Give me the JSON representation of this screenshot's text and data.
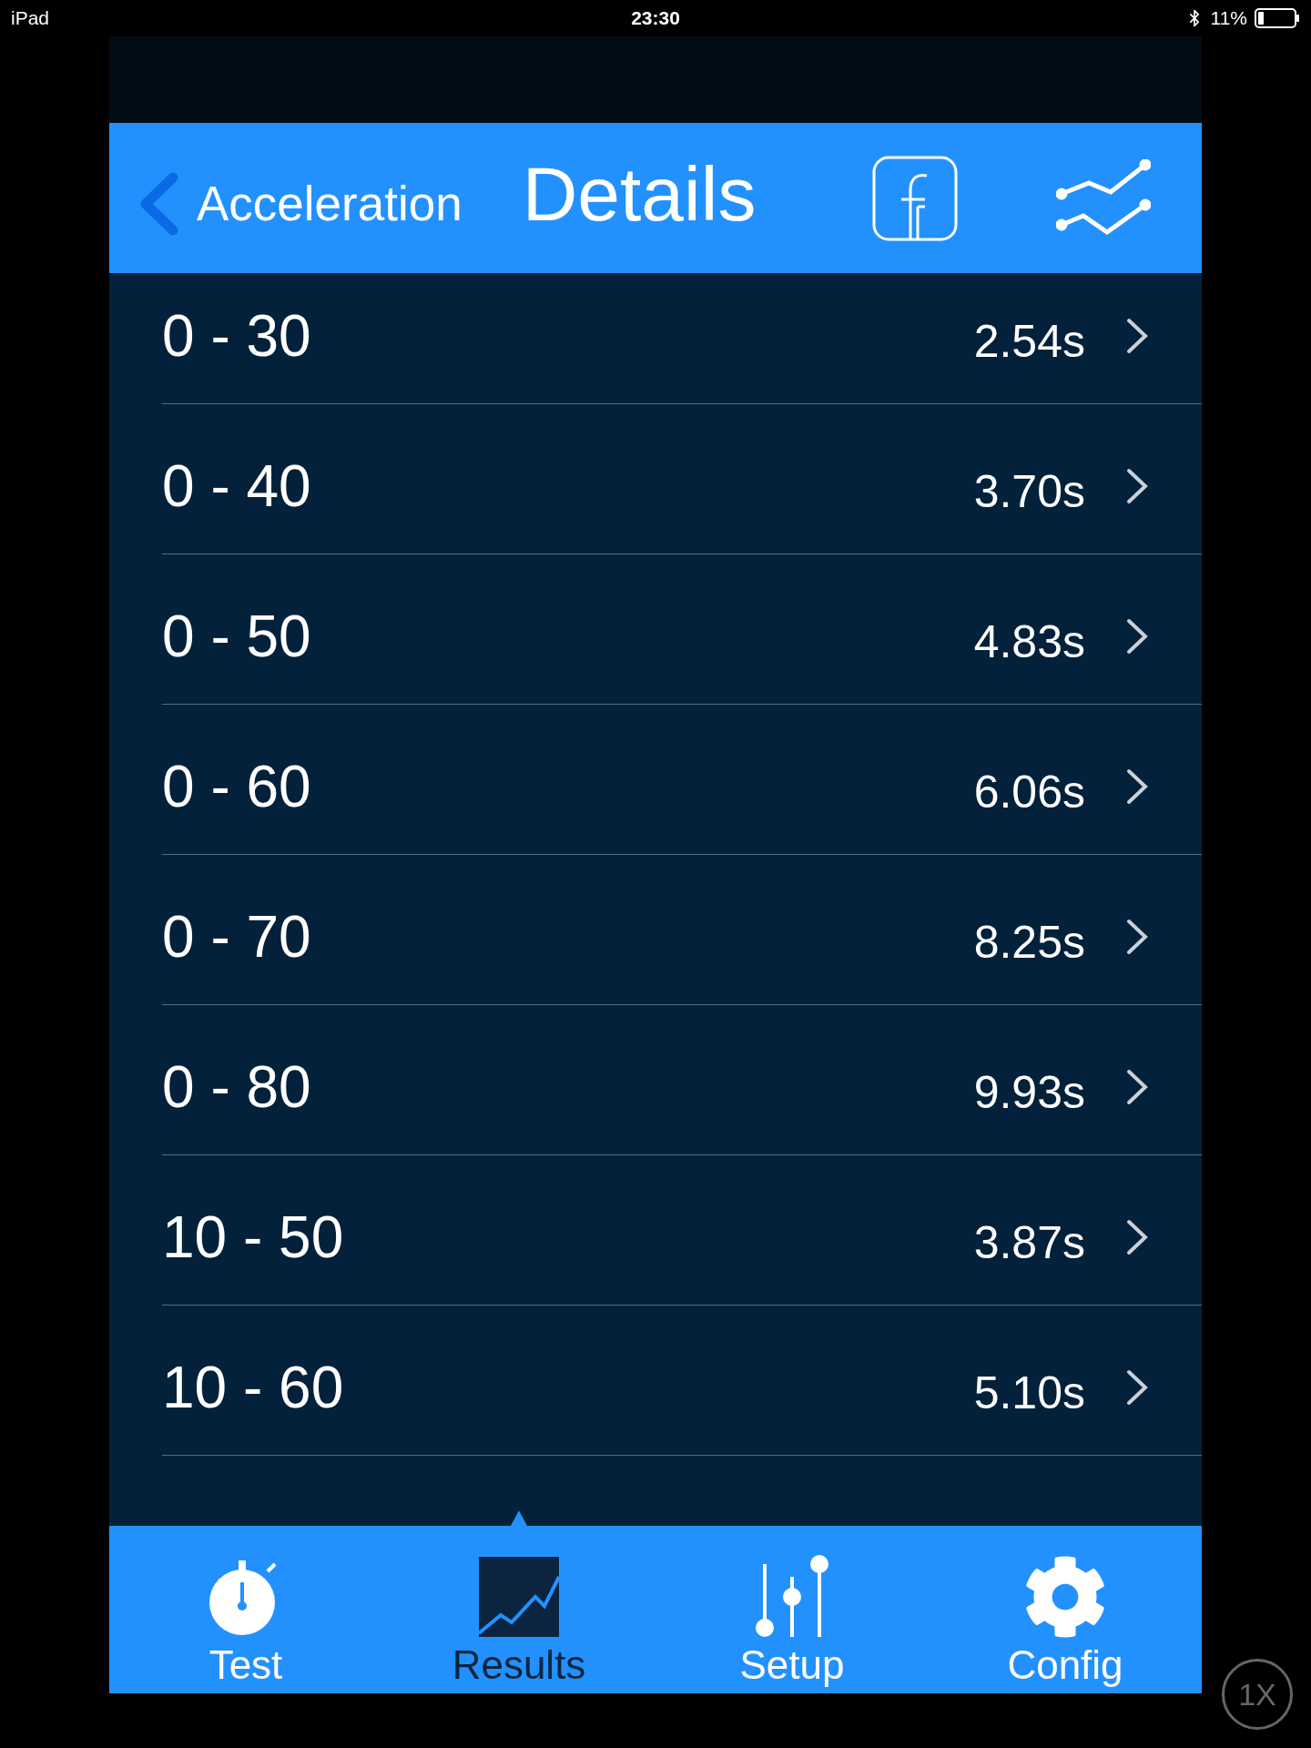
{
  "status_bar": {
    "device": "iPad",
    "time": "23:30",
    "battery": "11%"
  },
  "nav_bar": {
    "back": "Acceleration",
    "title": "Details"
  },
  "rows": [
    {
      "range": "0 - 30",
      "time": "2.54s"
    },
    {
      "range": "0 - 40",
      "time": "3.70s"
    },
    {
      "range": "0 - 50",
      "time": "4.83s"
    },
    {
      "range": "0 - 60",
      "time": "6.06s"
    },
    {
      "range": "0 - 70",
      "time": "8.25s"
    },
    {
      "range": "0 - 80",
      "time": "9.93s"
    },
    {
      "range": "10 - 50",
      "time": "3.87s"
    },
    {
      "range": "10 - 60",
      "time": "5.10s"
    }
  ],
  "tab_bar": [
    {
      "kind": "stopwatch",
      "label": "Test",
      "selected": false
    },
    {
      "kind": "chart",
      "label": "Results",
      "selected": true
    },
    {
      "kind": "sliders",
      "label": "Setup",
      "selected": false
    },
    {
      "kind": "gear",
      "label": "Config",
      "selected": false
    }
  ],
  "zoom_button": "1X"
}
